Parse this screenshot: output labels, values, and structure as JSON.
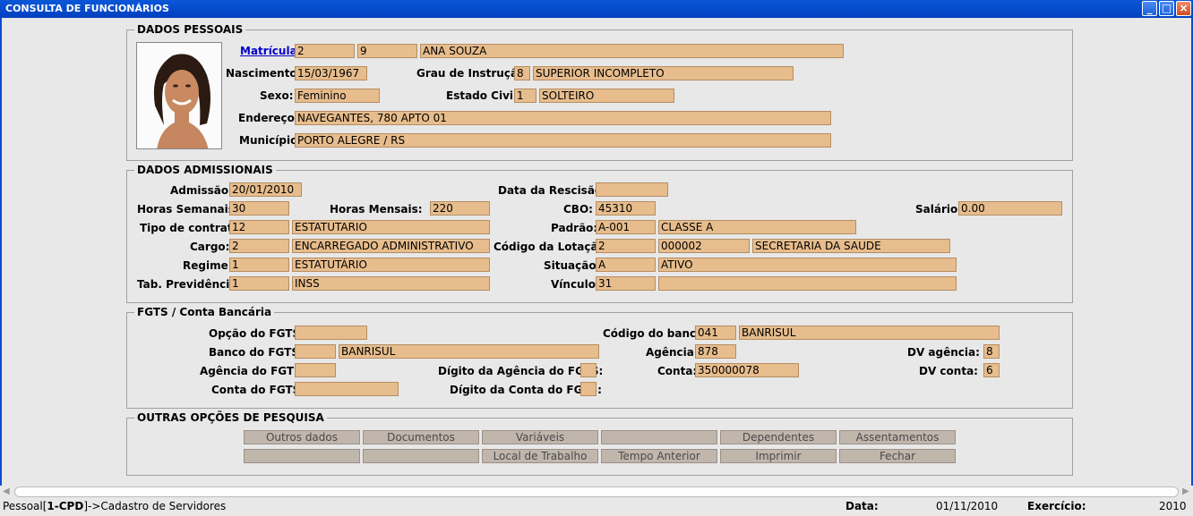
{
  "window": {
    "title": "CONSULTA DE FUNCIONÁRIOS"
  },
  "pessoais": {
    "legend": "DADOS PESSOAIS",
    "matricula_label": "Matrícula:",
    "matricula_a": "2",
    "matricula_b": "9",
    "nome": "ANA SOUZA",
    "nascimento_label": "Nascimento:",
    "nascimento": "15/03/1967",
    "grau_label": "Grau de Instrução:",
    "grau_cod": "8",
    "grau": "SUPERIOR INCOMPLETO",
    "sexo_label": "Sexo:",
    "sexo": "Feminino",
    "estado_label": "Estado Civil:",
    "estado_cod": "1",
    "estado": "SOLTEIRO",
    "endereco_label": "Endereço:",
    "endereco": "NAVEGANTES, 780 APTO 01",
    "municipio_label": "Município:",
    "municipio": "PORTO ALEGRE / RS"
  },
  "admissionais": {
    "legend": "DADOS ADMISSIONAIS",
    "admissao_label": "Admissão:",
    "admissao": "20/01/2010",
    "rescisao_label": "Data da Rescisão:",
    "rescisao": "",
    "horas_sem_label": "Horas Semanais:",
    "horas_sem": "30",
    "horas_men_label": "Horas Mensais:",
    "horas_men": "220",
    "cbo_label": "CBO:",
    "cbo": "45310",
    "salario_label": "Salário:",
    "salario": "0.00",
    "tipo_label": "Tipo de contrato:",
    "tipo_cod": "12",
    "tipo": "ESTATUTARIO",
    "padrao_label": "Padrão:",
    "padrao_cod": "A-001",
    "padrao": "CLASSE A",
    "cargo_label": "Cargo:",
    "cargo_cod": "2",
    "cargo": "ENCARREGADO ADMINISTRATIVO",
    "lotacao_label": "Código da Lotação:",
    "lotacao_a": "2",
    "lotacao_b": "000002",
    "lotacao": "SECRETARIA DA SAUDE",
    "regime_label": "Regime:",
    "regime_cod": "1",
    "regime": "ESTATUTÁRIO",
    "situacao_label": "Situação:",
    "situacao_cod": "A",
    "situacao": "ATIVO",
    "prev_label": "Tab. Previdência:",
    "prev_cod": "1",
    "prev": "INSS",
    "vinculo_label": "Vínculo:",
    "vinculo_cod": "31",
    "vinculo": ""
  },
  "fgts": {
    "legend": "FGTS / Conta Bancária",
    "opcao_label": "Opção do FGTS:",
    "opcao": "",
    "banco_fgts_label": "Banco do FGTS:",
    "banco_fgts_cod": "",
    "banco_fgts": "BANRISUL",
    "agencia_fgts_label": "Agência do FGTS:",
    "agencia_fgts": "",
    "dig_ag_fgts_label": "Dígito da Agência do FGTS:",
    "dig_ag_fgts": "",
    "conta_fgts_label": "Conta do FGTS:",
    "conta_fgts": "",
    "dig_conta_fgts_label": "Dígito da Conta do FGTS:",
    "dig_conta_fgts": "",
    "cod_banco_label": "Código do banco:",
    "cod_banco": "041",
    "banco": "BANRISUL",
    "agencia_label": "Agência:",
    "agencia": "878",
    "dv_agencia_label": "DV agência:",
    "dv_agencia": "8",
    "conta_label": "Conta:",
    "conta": "350000078",
    "dv_conta_label": "DV conta:",
    "dv_conta": "6"
  },
  "outras": {
    "legend": "OUTRAS OPÇÕES DE PESQUISA",
    "row1": [
      "Outros dados",
      "Documentos",
      "Variáveis",
      "",
      "Dependentes",
      "Assentamentos"
    ],
    "row2": [
      "",
      "",
      "Local de Trabalho",
      "Tempo Anterior",
      "Imprimir",
      "Fechar"
    ]
  },
  "status": {
    "path_prefix": "Pessoal[",
    "path_bold": "1-CPD",
    "path_suffix": "]->Cadastro de Servidores",
    "data_label": "Data:",
    "data": "01/11/2010",
    "exercicio_label": "Exercício:",
    "exercicio": "2010"
  },
  "colors": {
    "titlebar": "#0a4fd0",
    "field": "#e7bd8d",
    "button": "#c0b6ac"
  }
}
